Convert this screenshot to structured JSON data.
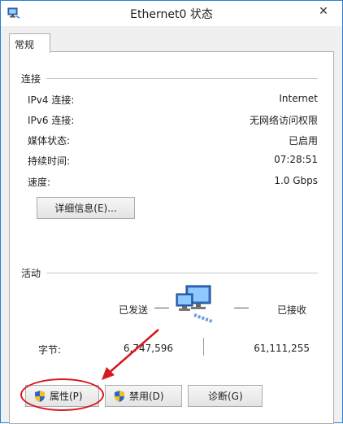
{
  "window": {
    "title": "Ethernet0 状态",
    "close_glyph": "✕"
  },
  "tabs": [
    {
      "label": "常规"
    }
  ],
  "connection": {
    "title": "连接",
    "rows": [
      {
        "label": "IPv4 连接:",
        "value": "Internet"
      },
      {
        "label": "IPv6 连接:",
        "value": "无网络访问权限"
      },
      {
        "label": "媒体状态:",
        "value": "已启用"
      },
      {
        "label": "持续时间:",
        "value": "07:28:51"
      },
      {
        "label": "速度:",
        "value": "1.0 Gbps"
      }
    ],
    "details_button": "详细信息(E)..."
  },
  "activity": {
    "title": "活动",
    "sent_label": "已发送",
    "received_label": "已接收",
    "bytes_label": "字节:",
    "bytes_sent": "6,747,596",
    "bytes_received": "61,111,255"
  },
  "buttons": {
    "properties": "属性(P)",
    "disable": "禁用(D)",
    "diagnose": "诊断(G)"
  },
  "colors": {
    "highlight": "#d9171f",
    "accent": "#2b7fd4"
  }
}
